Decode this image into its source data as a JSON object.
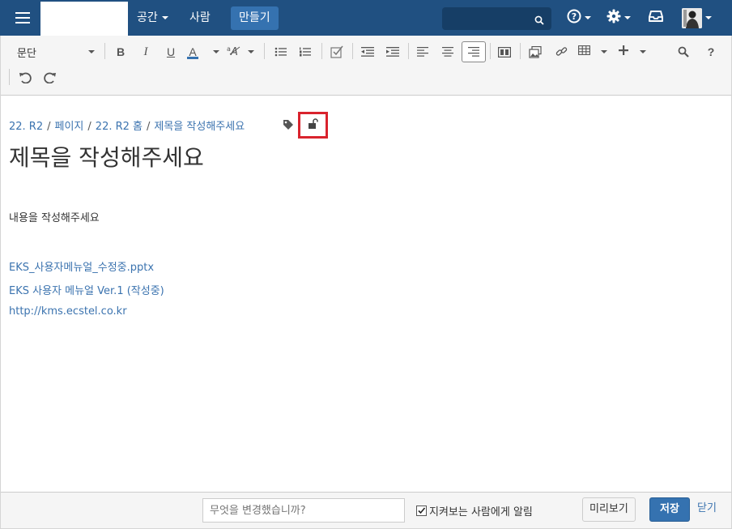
{
  "nav": {
    "menu_icon": "hamburger-menu-icon",
    "spaces": "공간",
    "people": "사람",
    "create": "만들기",
    "search_placeholder": "",
    "icons": [
      "help-icon",
      "gear-icon",
      "notifications-tray-icon",
      "user-avatar"
    ]
  },
  "toolbar": {
    "paragraph_format": "문단",
    "icons": [
      "bold-icon",
      "italic-icon",
      "underline-icon",
      "text-color-icon",
      "more-formatting-icon",
      "bullet-list-icon",
      "numbered-list-icon",
      "task-list-icon",
      "outdent-icon",
      "indent-icon",
      "align-left-icon",
      "align-center-icon",
      "align-right-icon",
      "page-layout-icon",
      "insert-files-icon",
      "link-icon",
      "table-icon",
      "insert-more-icon",
      "find-replace-icon",
      "help-icon",
      "undo-icon",
      "redo-icon"
    ],
    "bold": "B",
    "italic": "I",
    "underline": "U",
    "text_color": "A",
    "help": "?"
  },
  "breadcrumb": {
    "items": [
      "22. R2",
      "페이지",
      "22. R2 홈",
      "제목을 작성해주세요"
    ]
  },
  "page": {
    "title": "제목을 작성해주세요",
    "body": "내용을 작성해주세요",
    "links": [
      "EKS_사용자메뉴얼_수정중.pptx",
      "EKS 사용자 메뉴얼 Ver.1 (작성중)",
      "http://kms.ecstel.co.kr"
    ]
  },
  "footer": {
    "comment_placeholder": "무엇을 변경했습니까?",
    "comment_value": "",
    "notify_watchers_label": "지켜보는 사람에게 알림",
    "notify_watchers_checked": true,
    "preview": "미리보기",
    "save": "저장",
    "close": "닫기"
  },
  "colors": {
    "header": "#205081",
    "accent": "#3572b0",
    "link": "#3b73af",
    "highlight": "#d9232d"
  }
}
